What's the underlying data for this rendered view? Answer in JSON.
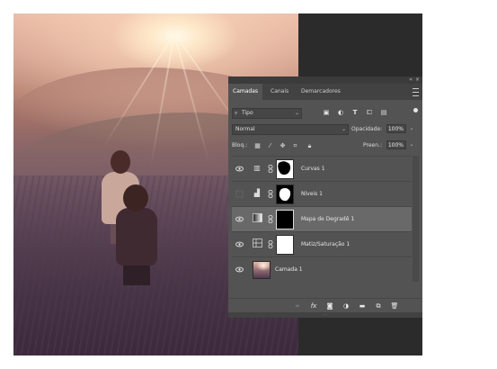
{
  "photo": {
    "description_icon": "photo-canvas"
  },
  "panel": {
    "tabs": [
      {
        "label": "Camadas",
        "active": true
      },
      {
        "label": "Canais",
        "active": false
      },
      {
        "label": "Demarcadores",
        "active": false
      }
    ],
    "filter": {
      "kind_label": "Tipo",
      "icons": [
        "image-filter-icon",
        "adjustment-filter-icon",
        "type-filter-icon",
        "shape-filter-icon",
        "smart-object-filter-icon"
      ]
    },
    "blend_mode": "Normal",
    "opacity_label": "Opacidade:",
    "opacity_value": "100%",
    "lock_label": "Bloq.:",
    "fill_label": "Preen.:",
    "fill_value": "100%",
    "layers": [
      {
        "name": "Curvas 1",
        "visible": true,
        "icon": "curves-icon",
        "mask": "curves",
        "selected": false
      },
      {
        "name": "Níveis 1",
        "visible": false,
        "icon": "levels-icon",
        "mask": "levels",
        "selected": false
      },
      {
        "name": "Mapa de Degradê 1",
        "visible": true,
        "icon": "gradient-map-icon",
        "mask": "black",
        "selected": true
      },
      {
        "name": "Matiz/Saturação 1",
        "visible": true,
        "icon": "hue-saturation-icon",
        "mask": "white",
        "selected": false
      },
      {
        "name": "Camada 1",
        "visible": true,
        "icon": "layer-thumbnail",
        "mask": "none",
        "selected": false
      }
    ],
    "bottom_icons": [
      "link-layers-icon",
      "fx-icon",
      "add-mask-icon",
      "new-adjustment-icon",
      "new-group-icon",
      "new-layer-icon",
      "trash-icon"
    ]
  },
  "colors": {
    "panel_bg": "#535353",
    "selected_row": "#696969",
    "dark_bg": "#2b2b2b"
  }
}
